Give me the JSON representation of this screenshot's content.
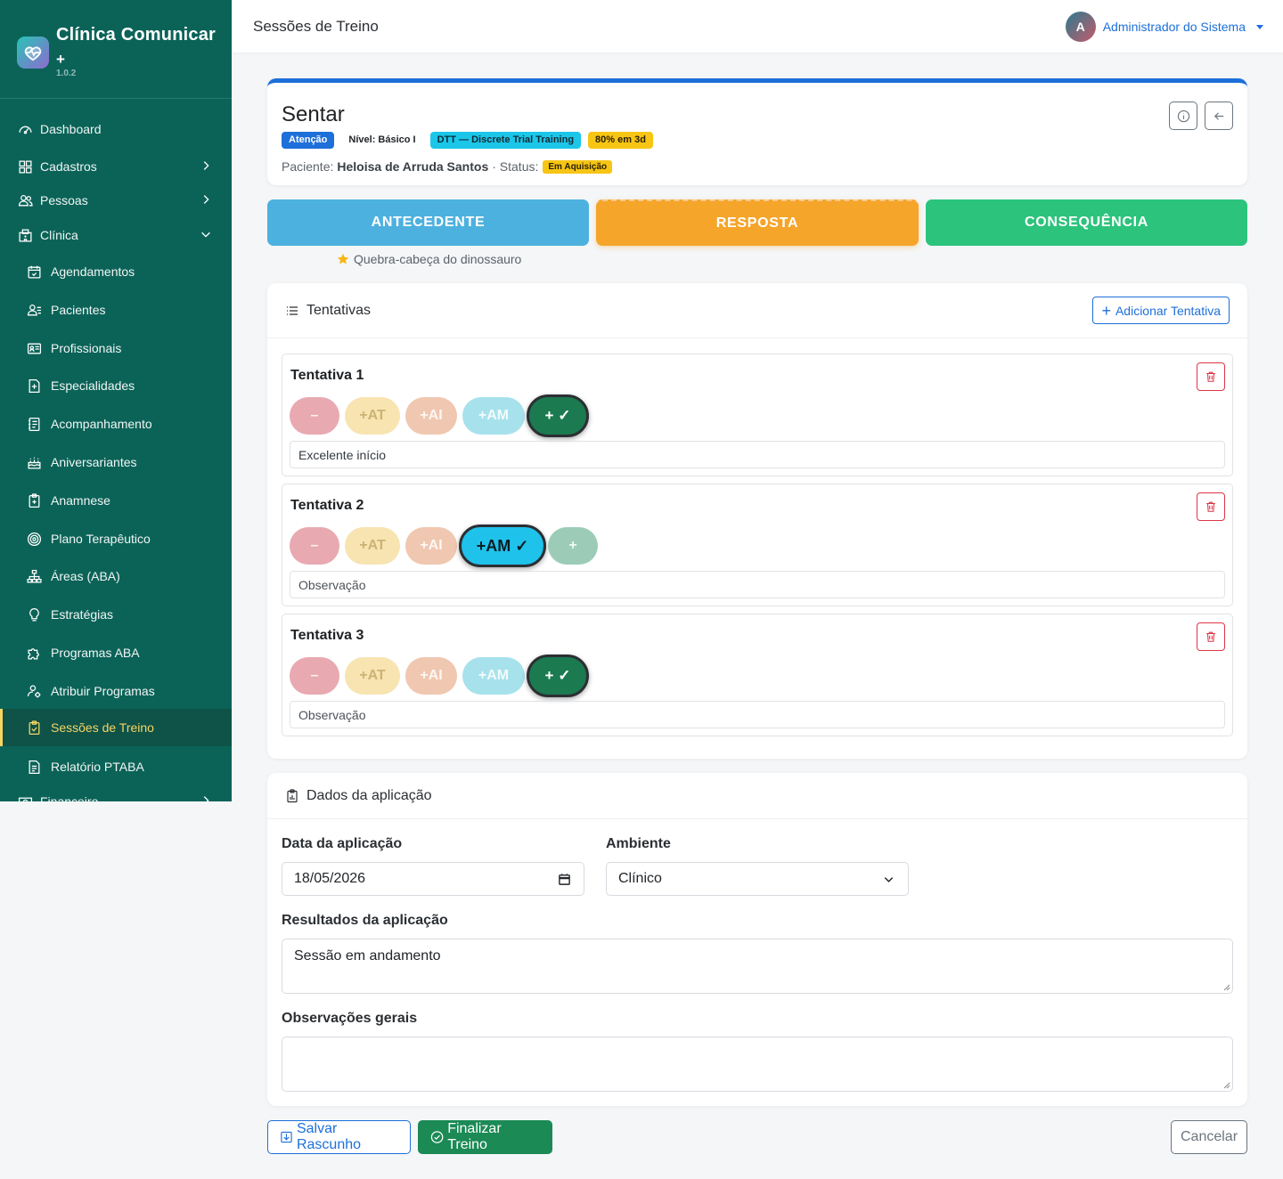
{
  "app": {
    "name": "Clínica Comunicar",
    "plus": "+",
    "version": "1.0.2"
  },
  "sidebar": {
    "items": [
      {
        "label": "Dashboard"
      },
      {
        "label": "Cadastros"
      },
      {
        "label": "Pessoas"
      },
      {
        "label": "Clínica"
      },
      {
        "label": "Agendamentos"
      },
      {
        "label": "Pacientes"
      },
      {
        "label": "Profissionais"
      },
      {
        "label": "Especialidades"
      },
      {
        "label": "Acompanhamento"
      },
      {
        "label": "Aniversariantes"
      },
      {
        "label": "Anamnese"
      },
      {
        "label": "Plano Terapêutico"
      },
      {
        "label": "Áreas (ABA)"
      },
      {
        "label": "Estratégias"
      },
      {
        "label": "Programas ABA"
      },
      {
        "label": "Atribuir Programas"
      },
      {
        "label": "Sessões de Treino"
      },
      {
        "label": "Relatório PTABA"
      },
      {
        "label": "Financeiro"
      }
    ]
  },
  "header": {
    "title": "Sessões de Treino",
    "user_initial": "A",
    "user_name": "Administrador do Sistema"
  },
  "program": {
    "title": "Sentar",
    "badge_attention": "Atenção",
    "level": "Nível: Básico I",
    "method": "DTT — Discrete Trial Training",
    "criterion": "80% em 3d",
    "patient_label": "Paciente:",
    "patient_name": "Heloisa de Arruda Santos",
    "status_label": "· Status:",
    "status": "Em Aquisição"
  },
  "abc": {
    "antecedent": "ANTECEDENTE",
    "response": "RESPOSTA",
    "consequence": "CONSEQUÊNCIA",
    "stimulus": "Quebra-cabeça do dinossauro"
  },
  "trials": {
    "section_title": "Tentativas",
    "add_label": "Adicionar Tentativa",
    "items": [
      {
        "title": "Tentativa 1",
        "opt_minus": "–",
        "opt_at": "+AT",
        "opt_ai": "+AI",
        "opt_am": "+AM",
        "opt_plus": "+ ✓",
        "selected": "+",
        "observation": "Excelente início"
      },
      {
        "title": "Tentativa 2",
        "opt_minus": "–",
        "opt_at": "+AT",
        "opt_ai": "+AI",
        "opt_am": "+AM ✓",
        "opt_plus": "+",
        "selected": "+AM",
        "observation_placeholder": "Observação"
      },
      {
        "title": "Tentativa 3",
        "opt_minus": "–",
        "opt_at": "+AT",
        "opt_ai": "+AI",
        "opt_am": "+AM",
        "opt_plus": "+ ✓",
        "selected": "+",
        "observation_placeholder": "Observação"
      }
    ]
  },
  "application": {
    "section_title": "Dados da aplicação",
    "date_label": "Data da aplicação",
    "date_value": "18/05/2026",
    "env_label": "Ambiente",
    "env_value": "Clínico",
    "results_label": "Resultados da aplicação",
    "results_value": "Sessão em andamento",
    "notes_label": "Observações gerais",
    "notes_value": ""
  },
  "actions": {
    "save": "Salvar Rascunho",
    "finish": "Finalizar Treino",
    "cancel": "Cancelar"
  },
  "colors": {
    "sidebar": "#0b6358",
    "primary": "#1d6fd9",
    "success": "#1b8a55",
    "warning": "#f7c514",
    "antecedent": "#4db1df",
    "response": "#f5a52a",
    "consequence": "#2cc37c"
  }
}
